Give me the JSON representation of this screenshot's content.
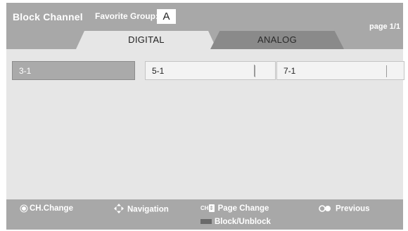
{
  "header": {
    "title": "Block Channel",
    "favorite_label": "Favorite Group:",
    "favorite_value": "A",
    "page": "page 1/1"
  },
  "tabs": [
    {
      "label": "DIGITAL",
      "active": true
    },
    {
      "label": "ANALOG",
      "active": false
    }
  ],
  "channels": [
    {
      "label": "3-1",
      "selected": true
    },
    {
      "label": "5-1",
      "selected": false
    },
    {
      "label": "7-1",
      "selected": false
    }
  ],
  "footer": {
    "ch_change": "CH.Change",
    "navigation": "Navigation",
    "ch_glyph": "CH",
    "page_change": "Page Change",
    "previous": "Previous",
    "block_unblock": "Block/Unblock"
  },
  "colors": {
    "panel": "#e6e6e6",
    "header": "#a8a8a8",
    "inactive_tab": "#8a8a8a",
    "selected_cell": "#aaaaaa"
  }
}
